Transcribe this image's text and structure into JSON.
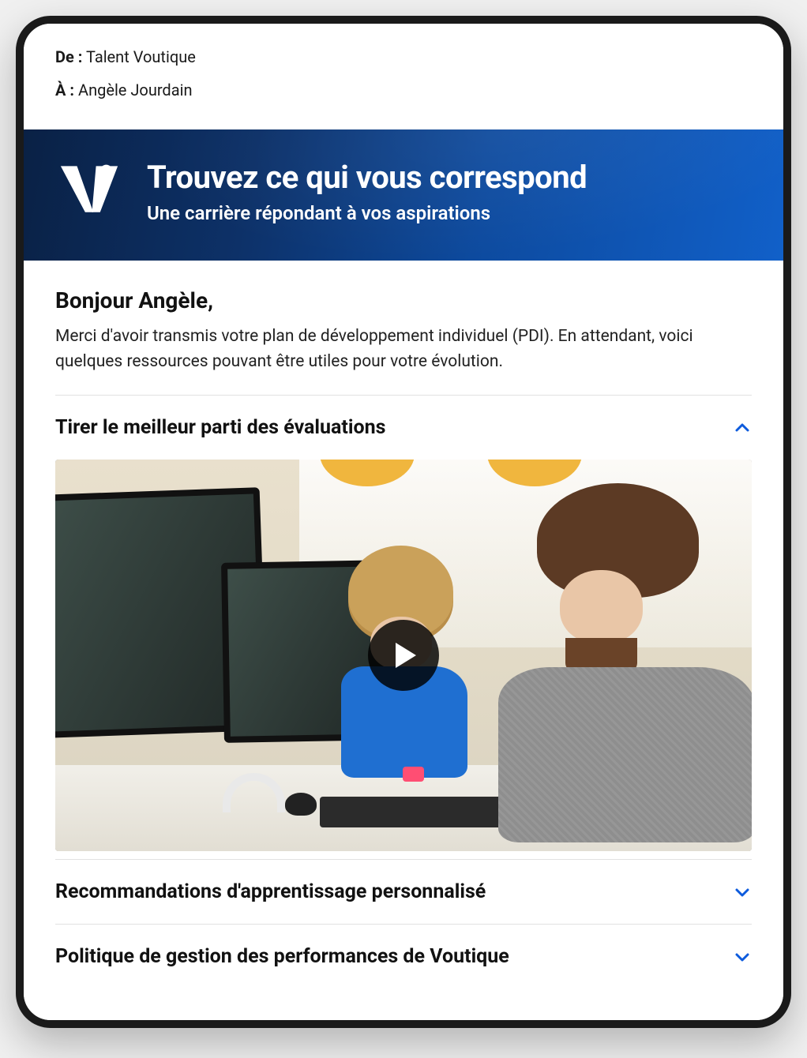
{
  "meta": {
    "from_label": "De :",
    "from_value": "Talent Voutique",
    "to_label": "À :",
    "to_value": "Angèle Jourdain"
  },
  "banner": {
    "title": "Trouvez ce qui vous correspond",
    "subtitle": "Une carrière répondant à vos aspirations"
  },
  "body": {
    "greeting": "Bonjour Angèle,",
    "intro": "Merci d'avoir transmis votre plan de développement individuel (PDI). En attendant, voici quelques ressources pouvant être utiles pour votre évolution."
  },
  "sections": [
    {
      "title": "Tirer le meilleur parti des évaluations",
      "expanded": true,
      "has_video": true
    },
    {
      "title": "Recommandations d'apprentissage personnalisé",
      "expanded": false
    },
    {
      "title": "Politique de gestion des performances de Voutique",
      "expanded": false
    }
  ]
}
